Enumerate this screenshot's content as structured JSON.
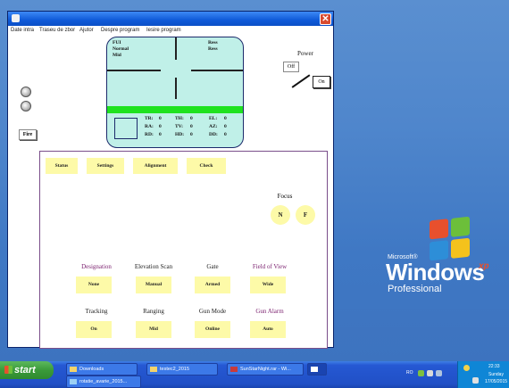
{
  "window": {
    "title_bar_text": "",
    "close_glyph": "✕",
    "menu": [
      "Date intra",
      "Traseu de zbor",
      "Ajutor",
      "Despre program",
      "Iesire program"
    ]
  },
  "hud": {
    "modes": [
      "FUI",
      "Normal",
      "Mid"
    ],
    "right_labels": [
      "Ress",
      "Ress"
    ],
    "readouts": [
      {
        "label": "TR:",
        "value": "0"
      },
      {
        "label": "TH:",
        "value": "0"
      },
      {
        "label": "EL:",
        "value": "0"
      },
      {
        "label": "RA:",
        "value": "0"
      },
      {
        "label": "TV:",
        "value": "0"
      },
      {
        "label": "AZ:",
        "value": "0"
      },
      {
        "label": "RD:",
        "value": "0"
      },
      {
        "label": "HD:",
        "value": "0"
      },
      {
        "label": "DD:",
        "value": "0"
      }
    ]
  },
  "power": {
    "label": "Power",
    "off_label": "Off",
    "on_label": "On"
  },
  "left_controls": {
    "fire_label": "Fire"
  },
  "panel": {
    "top_buttons": [
      "Status",
      "Settings",
      "Alignment",
      "Check"
    ],
    "focus": {
      "label": "Focus",
      "near": "N",
      "far": "F"
    },
    "row1": [
      {
        "label": "Designation",
        "value": "None",
        "color": "#7a1f6e"
      },
      {
        "label": "Elevation Scan",
        "value": "Manual",
        "color": "#222222"
      },
      {
        "label": "Gate",
        "value": "Armed",
        "color": "#222222"
      },
      {
        "label": "Field of View",
        "value": "Wide",
        "color": "#7a1f6e"
      }
    ],
    "row2": [
      {
        "label": "Tracking",
        "value": "On",
        "color": "#222222"
      },
      {
        "label": "Ranging",
        "value": "Mid",
        "color": "#222222"
      },
      {
        "label": "Gun Mode",
        "value": "Online",
        "color": "#222222"
      },
      {
        "label": "Gun Alarm",
        "value": "Auto",
        "color": "#7a1f6e"
      }
    ]
  },
  "desktop": {
    "logo_ms": "Microsoft®",
    "logo_windows": "Windows",
    "logo_xp": "xp",
    "logo_edition": "Professional"
  },
  "taskbar": {
    "start_label": "start",
    "tasks": [
      {
        "label": "Downloads"
      },
      {
        "label": "testec2_2015"
      },
      {
        "label": "SunStarNight.rar - Wi..."
      },
      {
        "label": ""
      },
      {
        "label": "rotatie_avarie_2015..."
      }
    ],
    "tray": {
      "lang": "RO",
      "time": "22:33",
      "day": "Sunday",
      "date": "17/05/2015"
    }
  },
  "colors": {
    "accent_yellow": "#fdfaa8",
    "hud_bg": "#c0f0e8",
    "hud_band": "#1fe21f",
    "purple_label": "#7a1f6e"
  }
}
